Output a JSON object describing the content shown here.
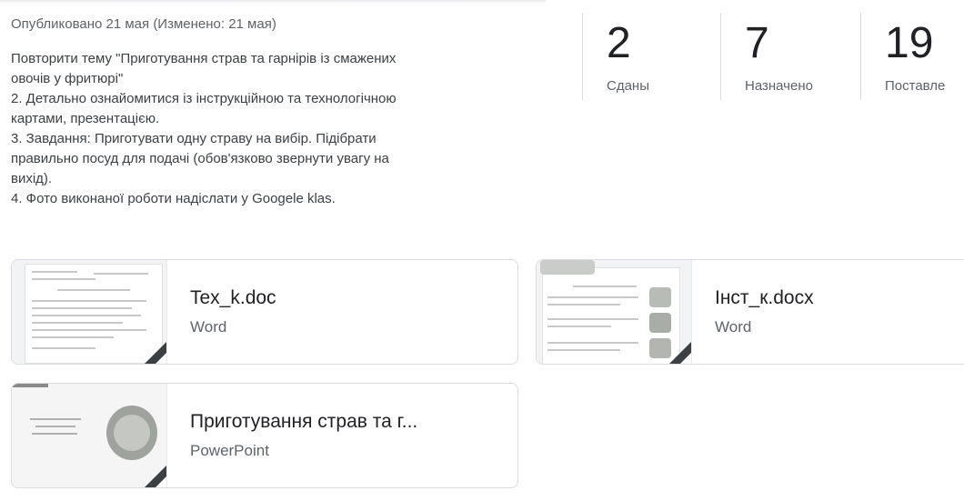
{
  "post": {
    "published": "Опубликовано 21 мая (Изменено: 21 мая)",
    "instructions": [
      "Повторити тему \"Приготування страв та гарнірів із смажених",
      "овочів у фритюрі\"",
      "2. Детально ознайомитися із інструкційною та технологічною",
      "картами, презентацією.",
      "3. Завдання: Приготувати одну страву на вибір. Підібрати",
      "правильно посуд для подачі (обов'язково звернути увагу на",
      "вихід).",
      "4. Фото виконаної роботи надіслати у Googele klas."
    ]
  },
  "stats": [
    {
      "number": "2",
      "label": "Сданы"
    },
    {
      "number": "7",
      "label": "Назначено"
    },
    {
      "number": "19",
      "label": "Поставле"
    }
  ],
  "attachments": [
    {
      "name": "Tex_k.doc",
      "type": "Word",
      "icon": "file-thumbnail-icon"
    },
    {
      "name": "Інст_к.docx",
      "type": "Word",
      "icon": "file-thumbnail-icon"
    },
    {
      "name": "Приготування страв та г...",
      "type": "PowerPoint",
      "icon": "file-thumbnail-icon"
    }
  ],
  "colors": {
    "text": "#3c4043",
    "muted": "#5f6368",
    "border": "#dadce0"
  }
}
